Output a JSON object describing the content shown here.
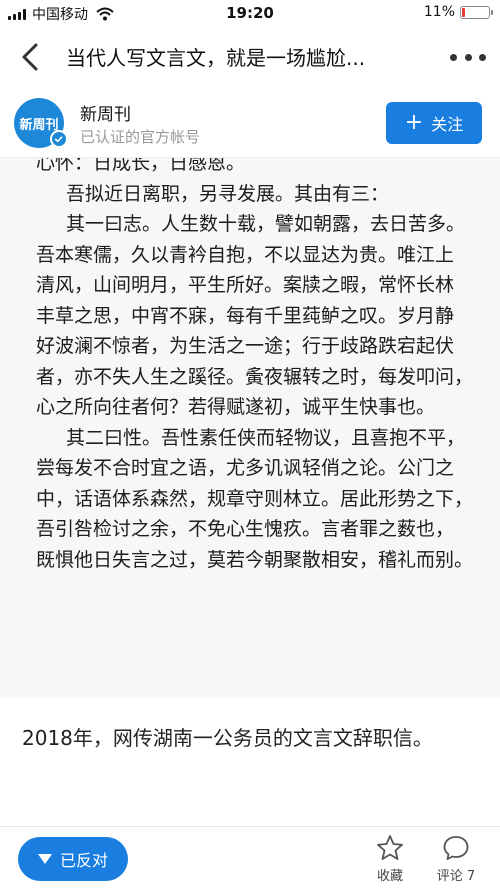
{
  "status": {
    "carrier": "中国移动",
    "time": "19:20",
    "battery": "11%",
    "battery_level": 0.11,
    "battery_color": "#e53935"
  },
  "nav": {
    "title": "当代人写文言文，就是一场尴尬...",
    "back_icon": "chevron-left-icon",
    "more_icon": "more-dots-icon"
  },
  "account": {
    "avatar_text": "新周刊",
    "name": "新周刊",
    "subtitle": "已认证的官方帐号",
    "follow_label": "关注"
  },
  "letter": {
    "lines": [
      {
        "text": "心怀：日成长，日感恩。",
        "indent": false
      },
      {
        "text": "吾拟近日离职，另寻发展。其由有三：",
        "indent": true
      },
      {
        "text": "其一曰志。人生数十载，譬如朝露，去日苦多。",
        "indent": true
      },
      {
        "text": "吾本寒儒，久以青衿自抱，不以显达为贵。唯江上",
        "indent": false
      },
      {
        "text": "清风，山间明月，平生所好。案牍之暇，常怀长林",
        "indent": false
      },
      {
        "text": "丰草之思，中宵不寐，每有千里莼鲈之叹。岁月静",
        "indent": false
      },
      {
        "text": "好波澜不惊者，为生活之一途；行于歧路跌宕起伏",
        "indent": false
      },
      {
        "text": "者，亦不失人生之蹊径。夤夜辗转之时，每发叩问，",
        "indent": false
      },
      {
        "text": "心之所向往者何？若得赋遂初，诚平生快事也。",
        "indent": false
      },
      {
        "text": "其二曰性。吾性素任侠而轻物议，且喜抱不平，",
        "indent": true
      },
      {
        "text": "尝每发不合时宜之语，尤多讥讽轻俏之论。公门之",
        "indent": false
      },
      {
        "text": "中，话语体系森然，规章守则林立。居此形势之下，",
        "indent": false
      },
      {
        "text": "吾引咎检讨之余，不免心生愧疚。言者罪之薮也，",
        "indent": false
      },
      {
        "text": "既惧他日失言之过，莫若今朝聚散相安，稽礼而别。",
        "indent": false
      }
    ]
  },
  "caption": "2018年，网传湖南一公务员的文言文辞职信。",
  "bottom": {
    "oppose_label": "已反对",
    "favorite_label": "收藏",
    "comment_label": "评论 7"
  },
  "colors": {
    "accent": "#1a7ee0"
  }
}
